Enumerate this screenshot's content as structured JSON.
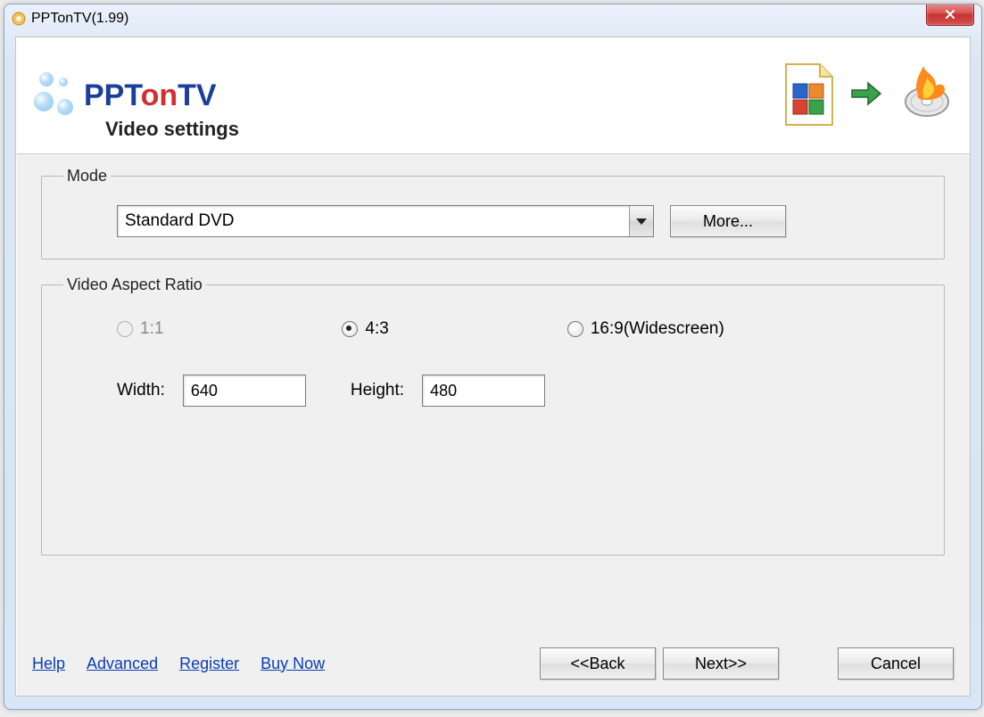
{
  "window": {
    "title": "PPTonTV(1.99)"
  },
  "header": {
    "logo_part1": "PPT",
    "logo_part2": "on",
    "logo_part3": "TV",
    "subtitle": "Video settings"
  },
  "mode": {
    "legend": "Mode",
    "selected": "Standard DVD",
    "more_button": "More..."
  },
  "aspect": {
    "legend": "Video Aspect Ratio",
    "options": {
      "o0": {
        "label": "1:1",
        "selected": false,
        "disabled": true
      },
      "o1": {
        "label": "4:3",
        "selected": true,
        "disabled": false
      },
      "o2": {
        "label": "16:9(Widescreen)",
        "selected": false,
        "disabled": false
      }
    },
    "width_label": "Width:",
    "width_value": "640",
    "height_label": "Height:",
    "height_value": "480"
  },
  "links": {
    "help": "Help",
    "advanced": "Advanced",
    "register": "Register",
    "buy_now": "Buy Now"
  },
  "buttons": {
    "back": "<<Back",
    "next": "Next>>",
    "cancel": "Cancel"
  }
}
